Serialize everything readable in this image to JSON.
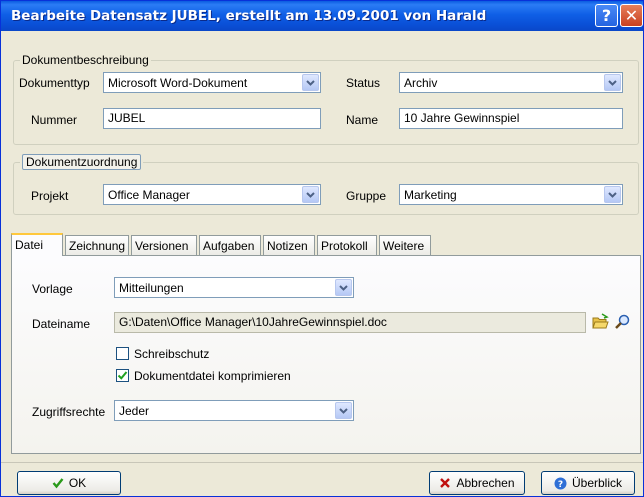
{
  "window": {
    "title": "Bearbeite Datensatz JUBEL, erstellt am 13.09.2001 von Harald",
    "help_glyph": "?",
    "close_glyph": "✕"
  },
  "beschreibung": {
    "legend": "Dokumentbeschreibung",
    "dokumenttyp_label": "Dokumenttyp",
    "dokumenttyp_value": "Microsoft Word-Dokument",
    "status_label": "Status",
    "status_value": "Archiv",
    "nummer_label": "Nummer",
    "nummer_value": "JUBEL",
    "name_label": "Name",
    "name_value": "10 Jahre Gewinnspiel"
  },
  "zuordnung": {
    "legend": "Dokumentzuordnung",
    "projekt_label": "Projekt",
    "projekt_value": "Office Manager",
    "gruppe_label": "Gruppe",
    "gruppe_value": "Marketing"
  },
  "tabs": [
    {
      "label": "Datei",
      "active": true
    },
    {
      "label": "Zeichnung"
    },
    {
      "label": "Versionen"
    },
    {
      "label": "Aufgaben"
    },
    {
      "label": "Notizen"
    },
    {
      "label": "Protokoll"
    },
    {
      "label": "Weitere"
    }
  ],
  "datei": {
    "vorlage_label": "Vorlage",
    "vorlage_value": "Mitteilungen",
    "dateiname_label": "Dateiname",
    "dateiname_value": "G:\\Daten\\Office Manager\\10JahreGewinnspiel.doc",
    "schreibschutz_label": "Schreibschutz",
    "schreibschutz_checked": false,
    "komprimieren_label": "Dokumentdatei komprimieren",
    "komprimieren_checked": true,
    "zugriff_label": "Zugriffsrechte",
    "zugriff_value": "Jeder"
  },
  "buttons": {
    "ok": "OK",
    "abbrechen": "Abbrechen",
    "ueberblick": "Überblick"
  },
  "colors": {
    "titlebar": "#0a5be0",
    "active_tab_accent": "#ffc83c",
    "ok_check": "#2a9a1a",
    "cancel_x": "#c01010"
  }
}
